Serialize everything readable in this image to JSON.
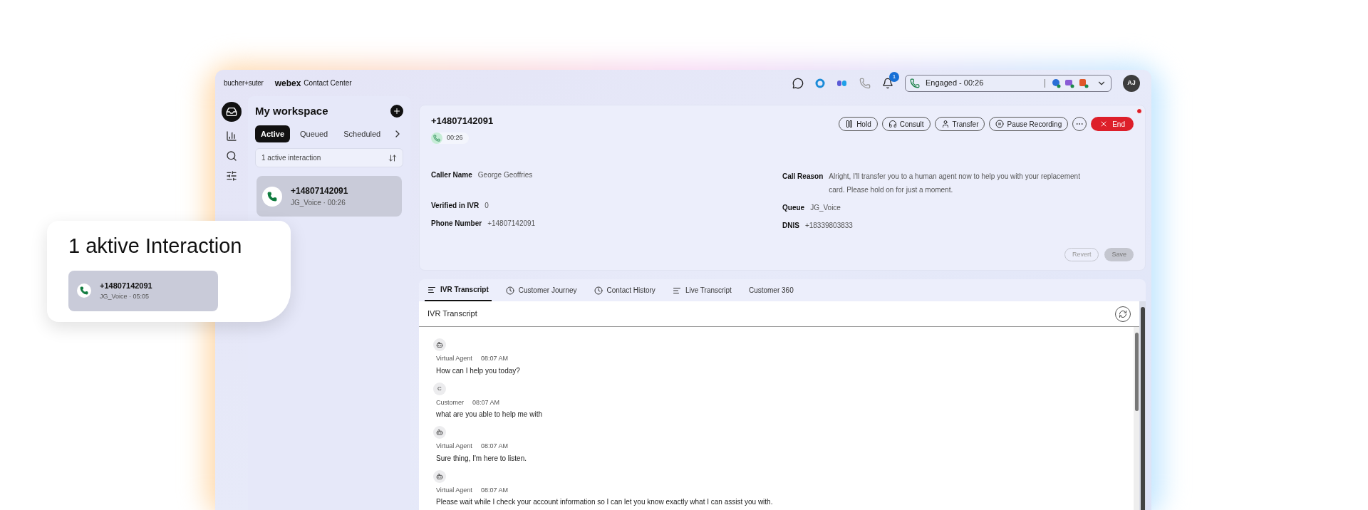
{
  "header": {
    "brand": "bucher+suter",
    "product": "webex",
    "product_suffix": "Contact Center",
    "notification_count": "1",
    "status": "Engaged - 00:26",
    "avatar": "AJ"
  },
  "workspace": {
    "title": "My workspace",
    "tabs": [
      {
        "label": "Active",
        "selected": true
      },
      {
        "label": "Queued",
        "selected": false
      },
      {
        "label": "Scheduled",
        "selected": false
      }
    ],
    "filter": "1 active interaction",
    "interactions": [
      {
        "number": "+14807142091",
        "detail": "JG_Voice · 00:26",
        "selected": true
      }
    ]
  },
  "call": {
    "number": "+14807142091",
    "timer": "00:26",
    "actions": [
      {
        "kind": "hold",
        "label": "Hold"
      },
      {
        "kind": "consult",
        "label": "Consult"
      },
      {
        "kind": "transfer",
        "label": "Transfer"
      },
      {
        "kind": "record",
        "label": "Pause Recording"
      }
    ],
    "end_label": "End",
    "fields_left": [
      {
        "label": "Caller Name",
        "value": "George Geoffries"
      },
      {
        "label": "Verified in IVR",
        "value": "0"
      },
      {
        "label": "Phone Number",
        "value": "+14807142091"
      }
    ],
    "fields_right": [
      {
        "label": "Call Reason",
        "value": "Alright, I'll transfer you to a human agent now to help you with your replacement card. Please hold on for just a moment."
      },
      {
        "label": "Queue",
        "value": "JG_Voice"
      },
      {
        "label": "DNIS",
        "value": "+18339803833"
      }
    ],
    "form_buttons": [
      {
        "label": "Revert",
        "kind": "outline",
        "disabled": true
      },
      {
        "label": "Save",
        "kind": "filled",
        "disabled": true
      }
    ]
  },
  "detail_tabs": [
    {
      "label": "IVR Transcript",
      "kind": "lines",
      "selected": true
    },
    {
      "label": "Customer Journey",
      "kind": "clock",
      "selected": false
    },
    {
      "label": "Contact History",
      "kind": "clock",
      "selected": false
    },
    {
      "label": "Live Transcript",
      "kind": "lines",
      "selected": false
    },
    {
      "label": "Customer 360",
      "kind": "plain",
      "selected": false
    }
  ],
  "transcript": {
    "title": "IVR Transcript",
    "messages": [
      {
        "kind": "bot",
        "speaker": "Virtual Agent",
        "time": "08:07 AM",
        "text": "How can I help you today?"
      },
      {
        "kind": "customer",
        "initial": "C",
        "speaker": "Customer",
        "time": "08:07 AM",
        "text": "what are you able to help me with"
      },
      {
        "kind": "bot",
        "speaker": "Virtual Agent",
        "time": "08:07 AM",
        "text": "Sure thing, I'm here to listen."
      },
      {
        "kind": "bot",
        "speaker": "Virtual Agent",
        "time": "08:07 AM",
        "text": "Please wait while I check your account information so I can let you know exactly what I can assist you with."
      }
    ]
  },
  "callout": {
    "title": "1 aktive Interaction",
    "number": "+14807142091",
    "detail": "JG_Voice · 05:05"
  }
}
